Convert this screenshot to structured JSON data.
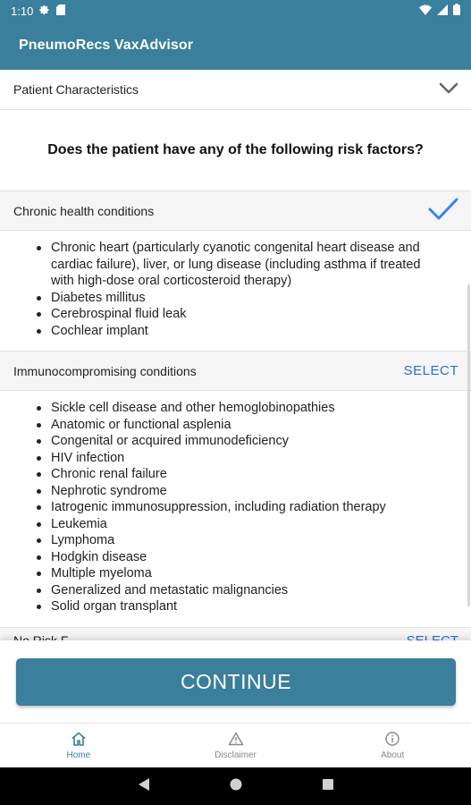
{
  "status_bar": {
    "time": "1:10"
  },
  "app_bar": {
    "title": "PneumoRecs VaxAdvisor"
  },
  "patient_section": {
    "label": "Patient Characteristics"
  },
  "question": "Does the patient have any of the following risk factors?",
  "groups": [
    {
      "label": "Chronic health conditions",
      "selected": true,
      "items": [
        "Chronic heart (particularly cyanotic congenital heart disease and cardiac failure), liver, or lung disease (including asthma if treated with high-dose oral corticosteroid therapy)",
        "Diabetes millitus",
        "Cerebrospinal fluid leak",
        "Cochlear implant"
      ]
    },
    {
      "label": "Immunocompromising conditions",
      "action": "SELECT",
      "items": [
        "Sickle cell disease and other hemoglobinopathies",
        "Anatomic or functional asplenia",
        "Congenital or acquired immunodeficiency",
        "HIV infection",
        "Chronic renal failure",
        "Nephrotic syndrome",
        "Iatrogenic immunosuppression, including radiation therapy",
        "Leukemia",
        "Lymphoma",
        "Hodgkin disease",
        "Multiple myeloma",
        "Generalized and metastatic malignancies",
        "Solid organ transplant"
      ]
    }
  ],
  "partial_group": {
    "label": "No Risk F...",
    "action": "SELECT"
  },
  "continue_label": "CONTINUE",
  "tabs": [
    {
      "label": "Home",
      "icon": "home-icon",
      "active": true
    },
    {
      "label": "Disclaimer",
      "icon": "warning-icon",
      "active": false
    },
    {
      "label": "About",
      "icon": "info-icon",
      "active": false
    }
  ],
  "colors": {
    "primary": "#3a7f9b",
    "link": "#2e6fd1",
    "check": "#3a84e0"
  }
}
